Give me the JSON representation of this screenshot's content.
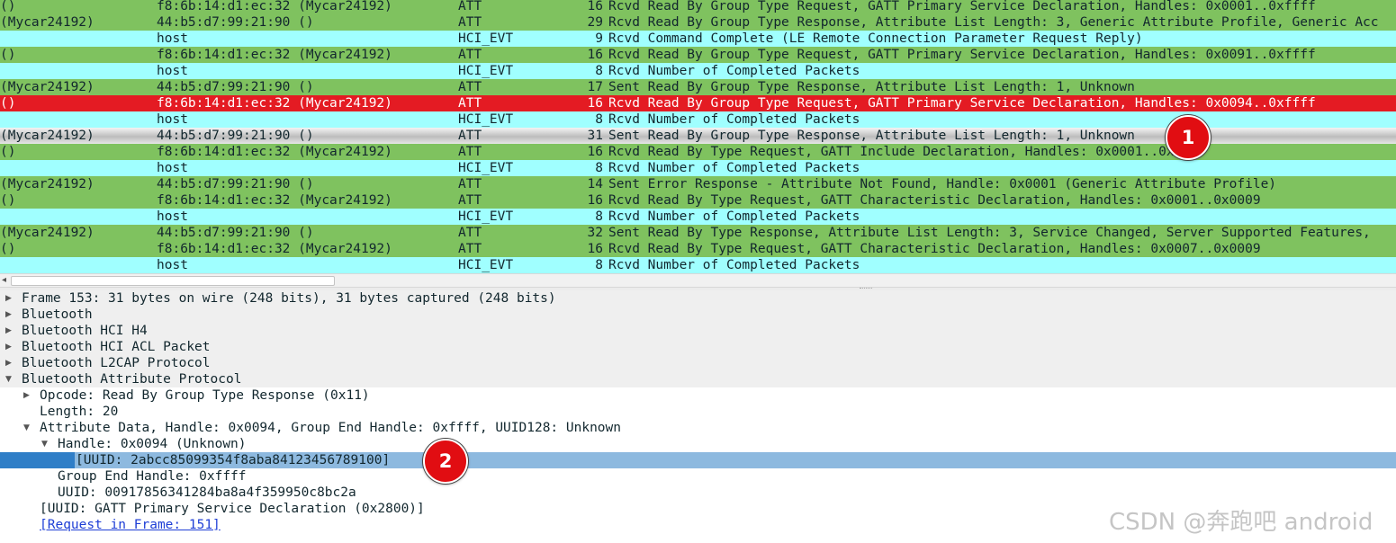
{
  "packets": [
    {
      "src": "()",
      "dst": "f8:6b:14:d1:ec:32 (Mycar24192)",
      "proto": "ATT",
      "len": "16",
      "info": "Rcvd Read By Group Type Request, GATT Primary Service Declaration, Handles: 0x0001..0xffff",
      "style": "att"
    },
    {
      "src": "(Mycar24192)",
      "dst": "44:b5:d7:99:21:90 ()",
      "proto": "ATT",
      "len": "29",
      "info": "Rcvd Read By Group Type Response, Attribute List Length: 3, Generic Attribute Profile, Generic Acc",
      "style": "att"
    },
    {
      "src": "",
      "dst": "host",
      "proto": "HCI_EVT",
      "len": "9",
      "info": "Rcvd Command Complete (LE Remote Connection Parameter Request Reply)",
      "style": "hci"
    },
    {
      "src": "()",
      "dst": "f8:6b:14:d1:ec:32 (Mycar24192)",
      "proto": "ATT",
      "len": "16",
      "info": "Rcvd Read By Group Type Request, GATT Primary Service Declaration, Handles: 0x0091..0xffff",
      "style": "att"
    },
    {
      "src": "",
      "dst": "host",
      "proto": "HCI_EVT",
      "len": "8",
      "info": "Rcvd Number of Completed Packets",
      "style": "hci"
    },
    {
      "src": "(Mycar24192)",
      "dst": "44:b5:d7:99:21:90 ()",
      "proto": "ATT",
      "len": "17",
      "info": "Sent Read By Group Type Response, Attribute List Length: 1, Unknown",
      "style": "att"
    },
    {
      "src": "()",
      "dst": "f8:6b:14:d1:ec:32 (Mycar24192)",
      "proto": "ATT",
      "len": "16",
      "info": "Rcvd Read By Group Type Request, GATT Primary Service Declaration, Handles: 0x0094..0xffff",
      "style": "sel-red"
    },
    {
      "src": "",
      "dst": "host",
      "proto": "HCI_EVT",
      "len": "8",
      "info": "Rcvd Number of Completed Packets",
      "style": "hci"
    },
    {
      "src": "(Mycar24192)",
      "dst": "44:b5:d7:99:21:90 ()",
      "proto": "ATT",
      "len": "31",
      "info": "Sent Read By Group Type Response, Attribute List Length: 1, Unknown",
      "style": "sel-gray"
    },
    {
      "src": "()",
      "dst": "f8:6b:14:d1:ec:32 (Mycar24192)",
      "proto": "ATT",
      "len": "16",
      "info": "Rcvd Read By Type Request, GATT Include Declaration, Handles: 0x0001..0x0009",
      "style": "att"
    },
    {
      "src": "",
      "dst": "host",
      "proto": "HCI_EVT",
      "len": "8",
      "info": "Rcvd Number of Completed Packets",
      "style": "hci"
    },
    {
      "src": "(Mycar24192)",
      "dst": "44:b5:d7:99:21:90 ()",
      "proto": "ATT",
      "len": "14",
      "info": "Sent Error Response - Attribute Not Found, Handle: 0x0001 (Generic Attribute Profile)",
      "style": "att"
    },
    {
      "src": "()",
      "dst": "f8:6b:14:d1:ec:32 (Mycar24192)",
      "proto": "ATT",
      "len": "16",
      "info": "Rcvd Read By Type Request, GATT Characteristic Declaration, Handles: 0x0001..0x0009",
      "style": "att"
    },
    {
      "src": "",
      "dst": "host",
      "proto": "HCI_EVT",
      "len": "8",
      "info": "Rcvd Number of Completed Packets",
      "style": "hci"
    },
    {
      "src": "(Mycar24192)",
      "dst": "44:b5:d7:99:21:90 ()",
      "proto": "ATT",
      "len": "32",
      "info": "Sent Read By Type Response, Attribute List Length: 3, Service Changed, Server Supported Features,",
      "style": "att"
    },
    {
      "src": "()",
      "dst": "f8:6b:14:d1:ec:32 (Mycar24192)",
      "proto": "ATT",
      "len": "16",
      "info": "Rcvd Read By Type Request, GATT Characteristic Declaration, Handles: 0x0007..0x0009",
      "style": "att"
    },
    {
      "src": "",
      "dst": "host",
      "proto": "HCI_EVT",
      "len": "8",
      "info": "Rcvd Number of Completed Packets",
      "style": "hci"
    }
  ],
  "details": [
    {
      "text": "Frame 153: 31 bytes on wire (248 bits), 31 bytes captured (248 bits)",
      "indent": 0,
      "arrow": "collapsed",
      "shaded": true
    },
    {
      "text": "Bluetooth",
      "indent": 0,
      "arrow": "collapsed",
      "shaded": true
    },
    {
      "text": "Bluetooth HCI H4",
      "indent": 0,
      "arrow": "collapsed",
      "shaded": true
    },
    {
      "text": "Bluetooth HCI ACL Packet",
      "indent": 0,
      "arrow": "collapsed",
      "shaded": true
    },
    {
      "text": "Bluetooth L2CAP Protocol",
      "indent": 0,
      "arrow": "collapsed",
      "shaded": true
    },
    {
      "text": "Bluetooth Attribute Protocol",
      "indent": 0,
      "arrow": "expanded",
      "shaded": true
    },
    {
      "text": "Opcode: Read By Group Type Response (0x11)",
      "indent": 1,
      "arrow": "collapsed"
    },
    {
      "text": "Length: 20",
      "indent": 1,
      "arrow": "none"
    },
    {
      "text": "Attribute Data, Handle: 0x0094, Group End Handle: 0xffff, UUID128: Unknown",
      "indent": 1,
      "arrow": "expanded"
    },
    {
      "text": "Handle: 0x0094 (Unknown)",
      "indent": 2,
      "arrow": "expanded"
    },
    {
      "text": "[UUID: 2abcc85099354f8aba84123456789100]",
      "indent": 3,
      "arrow": "none",
      "selected": true
    },
    {
      "text": "Group End Handle: 0xffff",
      "indent": 2,
      "arrow": "none"
    },
    {
      "text": "UUID: 00917856341284ba8a4f359950c8bc2a",
      "indent": 2,
      "arrow": "none"
    },
    {
      "text": "[UUID: GATT Primary Service Declaration (0x2800)]",
      "indent": 1,
      "arrow": "none"
    },
    {
      "text": "[Request in Frame: 151]",
      "indent": 1,
      "arrow": "none",
      "link": true
    }
  ],
  "badges": {
    "first": "1",
    "second": "2"
  },
  "watermark": "CSDN @奔跑吧 android",
  "scroll_left_icon": "◂"
}
